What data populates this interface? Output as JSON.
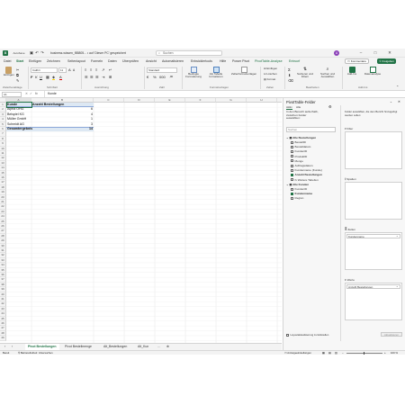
{
  "titlebar": {
    "autosave": "AutoSave",
    "filename": "business-wissen_f85805... • auf 'Dieser PC' gespeichert",
    "search_placeholder": "Suchen",
    "avatar_letter": "A"
  },
  "menu": {
    "tabs": [
      "Datei",
      "Start",
      "Einfügen",
      "Zeichnen",
      "Seitenlayout",
      "Formeln",
      "Daten",
      "Überprüfen",
      "Ansicht",
      "Automatisieren",
      "Entwicklertools",
      "Hilfe",
      "Power Pivot",
      "PivotTable-Analyse",
      "Entwurf"
    ],
    "active": "Start",
    "comments": "Kommentare",
    "share": "Freigeben"
  },
  "ribbon": {
    "paste": "Einfügen",
    "font_name": "Calibri",
    "font_size": "11",
    "number_format": "Standard",
    "cond_format": "Bedingte Formatierung",
    "as_table": "Als Tabelle formatieren",
    "cell_styles": "Zellenformatvorlagen",
    "insert": "Einfügen",
    "delete": "Löschen",
    "format": "Format",
    "sort_filter": "Sortieren und Filtern",
    "find_select": "Suchen und Auswählen",
    "add_ins": "Add-Ins",
    "data_analysis": "Datenanalyse",
    "groups": [
      "Zwischenablage",
      "Schriftart",
      "Ausrichtung",
      "Zahl",
      "Formatvorlagen",
      "Zellen",
      "Bearbeiten",
      "Add-Ins"
    ]
  },
  "formula": {
    "namebox": "A1",
    "fx": "fx",
    "value": "Kunde"
  },
  "columns": [
    "A",
    "B",
    "C",
    "D",
    "E",
    "F",
    "G",
    "H",
    "I"
  ],
  "table": {
    "headers": [
      "Kunde",
      "Anzahl Bestellungen"
    ],
    "rows": [
      {
        "name": "Alpha OHG",
        "value": "6"
      },
      {
        "name": "Beispiel KG",
        "value": "4"
      },
      {
        "name": "Müller GmbH",
        "value": "1"
      },
      {
        "name": "Schmidt AG",
        "value": "3"
      }
    ],
    "total_label": "Gesamtergebnis",
    "total_value": "14"
  },
  "pane": {
    "title": "PivotTable-Felder",
    "subtitle": "Felder auswählen, die dem Bericht hinzugefügt werden sollen:",
    "search_placeholder": "Suchen",
    "tab_active": "Aktiv",
    "tab_all": "Alle",
    "hint": "In den Bereich außerhalb, zwischen Felder auswählen:",
    "table1": "Alle Bestellungen",
    "fields1": [
      {
        "label": "BestellID",
        "checked": false
      },
      {
        "label": "Bestelldatum",
        "checked": false
      },
      {
        "label": "KundenID",
        "checked": false
      },
      {
        "label": "ProduktID",
        "checked": false
      },
      {
        "label": "Menge",
        "checked": false
      },
      {
        "label": "Auftragsdatum",
        "checked": false
      },
      {
        "label": "Kundenname (Kunde)",
        "checked": false
      },
      {
        "label": "Anzahl Bestellungen",
        "checked": true
      },
      {
        "label": "fx Weitere Tabellen",
        "checked": false
      }
    ],
    "table2": "Alle Kunden",
    "fields2": [
      {
        "label": "KundenID",
        "checked": false
      },
      {
        "label": "Kundenname",
        "checked": true
      },
      {
        "label": "Region",
        "checked": false
      }
    ],
    "filter_label": "Filter",
    "columns_label": "Spalten",
    "rows_label": "Zeilen",
    "rows_item": "Kundenname",
    "values_label": "Werte",
    "values_item": "Anzahl Bestellungen",
    "defer": "Layoutaktualisierung zurückstellen",
    "update": "Aktualisieren"
  },
  "sheets": {
    "tabs": [
      "Pivot Bestellungen",
      "Pivot Bestellmenge",
      "Alt_Bestellungen",
      "Alt_Kun"
    ],
    "active": "Pivot Bestellungen"
  },
  "status": {
    "ready": "Bereit",
    "accessibility": "Barrierefreiheit: Untersuchen",
    "display": "Anzeigeeinstellungen",
    "zoom": "100 %"
  },
  "colors": {
    "accent": "#217346",
    "header_fill": "#dde8f3",
    "total_fill": "#dde8f3"
  }
}
